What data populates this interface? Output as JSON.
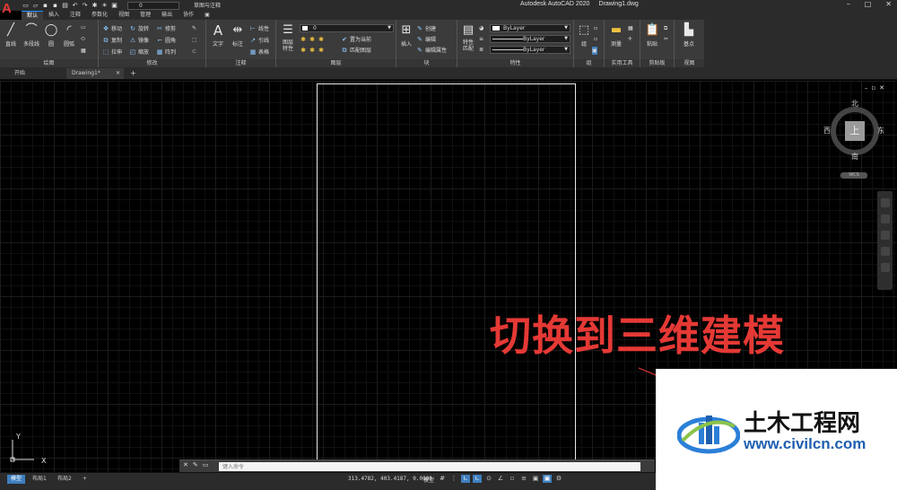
{
  "app": {
    "logo_letter": "A",
    "window_title": "Autodesk AutoCAD 2020",
    "document_name": "Drawing1.dwg",
    "workspace": "草图与注释",
    "quick_layer": "0",
    "accent_color": "#1e90ff"
  },
  "ribbon_tabs": [
    "默认",
    "插入",
    "注释",
    "参数化",
    "视图",
    "管理",
    "输出",
    "协作"
  ],
  "ribbon": {
    "draw": {
      "title": "绘图",
      "line": "直线",
      "polyline": "多段线",
      "circle": "圆",
      "arc": "圆弧"
    },
    "modify": {
      "title": "修改",
      "move": "移动",
      "copy": "复制",
      "stretch": "拉伸",
      "rotate": "旋转",
      "mirror": "镜像",
      "scale": "缩放",
      "trim": "修剪",
      "fillet": "圆角",
      "array": "阵列"
    },
    "annotation": {
      "title": "注释",
      "text": "文字",
      "dimension": "标注",
      "linear": "线性",
      "leader": "引线",
      "table": "表格"
    },
    "layers": {
      "title": "图层",
      "layer_properties": "图层特性",
      "current_layer": "0",
      "set_current": "置为当前",
      "match_layer": "匹配图层"
    },
    "block": {
      "title": "块",
      "insert": "插入",
      "create": "创建",
      "edit": "编辑",
      "edit_attributes": "编辑属性"
    },
    "properties": {
      "title": "特性",
      "match": "特性匹配",
      "color": "ByLayer",
      "linetype": "ByLayer",
      "lineweight": "ByLayer"
    },
    "groups": {
      "title": "组",
      "group": "组"
    },
    "utilities": {
      "title": "实用工具",
      "measure": "测量"
    },
    "clipboard": {
      "title": "剪贴板",
      "paste": "粘贴"
    },
    "view": {
      "title": "视图",
      "base": "基点"
    }
  },
  "file_tabs": {
    "start": "开始",
    "drawing": "Drawing1*"
  },
  "viewcube": {
    "north": "北",
    "south": "南",
    "west": "西",
    "east": "东",
    "face": "上",
    "wcs": "WCS"
  },
  "ucs": {
    "x": "X",
    "y": "Y"
  },
  "annotation_text": "切换到三维建模",
  "command_line": {
    "placeholder": "键入命令"
  },
  "status_bar": {
    "layout_tabs": [
      "模型",
      "布局1",
      "布局2"
    ],
    "coordinates": "313.4782, 403.4187, 0.0000",
    "model_label": "模型"
  },
  "watermark": {
    "title": "土木工程网",
    "url": "www.civilcn.com",
    "brand_color": "#1f5fb0"
  }
}
